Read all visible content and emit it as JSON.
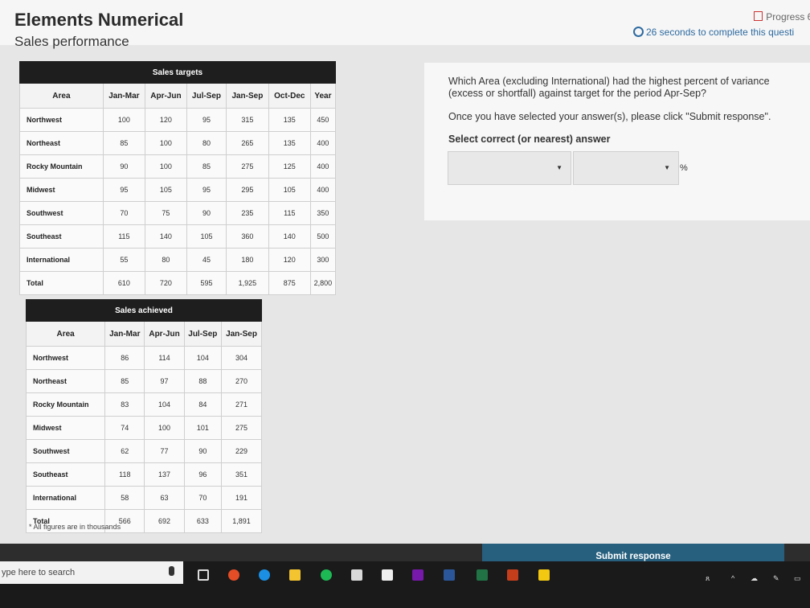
{
  "header": {
    "title": "Elements Numerical",
    "subtitle": "Sales performance",
    "progress": "Progress 6 /",
    "timer": "26 seconds to complete this questi"
  },
  "targets": {
    "caption": "Sales targets",
    "columns": [
      "Area",
      "Jan-Mar",
      "Apr-Jun",
      "Jul-Sep",
      "Jan-Sep",
      "Oct-Dec",
      "Year"
    ],
    "rows": [
      [
        "Northwest",
        "100",
        "120",
        "95",
        "315",
        "135",
        "450"
      ],
      [
        "Northeast",
        "85",
        "100",
        "80",
        "265",
        "135",
        "400"
      ],
      [
        "Rocky Mountain",
        "90",
        "100",
        "85",
        "275",
        "125",
        "400"
      ],
      [
        "Midwest",
        "95",
        "105",
        "95",
        "295",
        "105",
        "400"
      ],
      [
        "Southwest",
        "70",
        "75",
        "90",
        "235",
        "115",
        "350"
      ],
      [
        "Southeast",
        "115",
        "140",
        "105",
        "360",
        "140",
        "500"
      ],
      [
        "International",
        "55",
        "80",
        "45",
        "180",
        "120",
        "300"
      ],
      [
        "Total",
        "610",
        "720",
        "595",
        "1,925",
        "875",
        "2,800"
      ]
    ]
  },
  "achieved": {
    "caption": "Sales achieved",
    "columns": [
      "Area",
      "Jan-Mar",
      "Apr-Jun",
      "Jul-Sep",
      "Jan-Sep"
    ],
    "rows": [
      [
        "Northwest",
        "86",
        "114",
        "104",
        "304"
      ],
      [
        "Northeast",
        "85",
        "97",
        "88",
        "270"
      ],
      [
        "Rocky Mountain",
        "83",
        "104",
        "84",
        "271"
      ],
      [
        "Midwest",
        "74",
        "100",
        "101",
        "275"
      ],
      [
        "Southwest",
        "62",
        "77",
        "90",
        "229"
      ],
      [
        "Southeast",
        "118",
        "137",
        "96",
        "351"
      ],
      [
        "International",
        "58",
        "63",
        "70",
        "191"
      ],
      [
        "Total",
        "566",
        "692",
        "633",
        "1,891"
      ]
    ]
  },
  "footnote": "* All figures are in thousands",
  "question": {
    "text": "Which Area (excluding International) had the highest percent of variance (excess or shortfall) against target for the period Apr-Sep?",
    "instruction": "Once you have selected your answer(s), please click \"Submit response\".",
    "select_label": "Select correct (or nearest) answer",
    "unit": "%",
    "area_value": "",
    "percent_value": ""
  },
  "submit_label": "Submit response",
  "taskbar": {
    "search_placeholder": "ype here to search"
  },
  "colors": {
    "accent": "#27607e",
    "table_header": "#1e1e1e",
    "timer": "#2d6aa0"
  }
}
